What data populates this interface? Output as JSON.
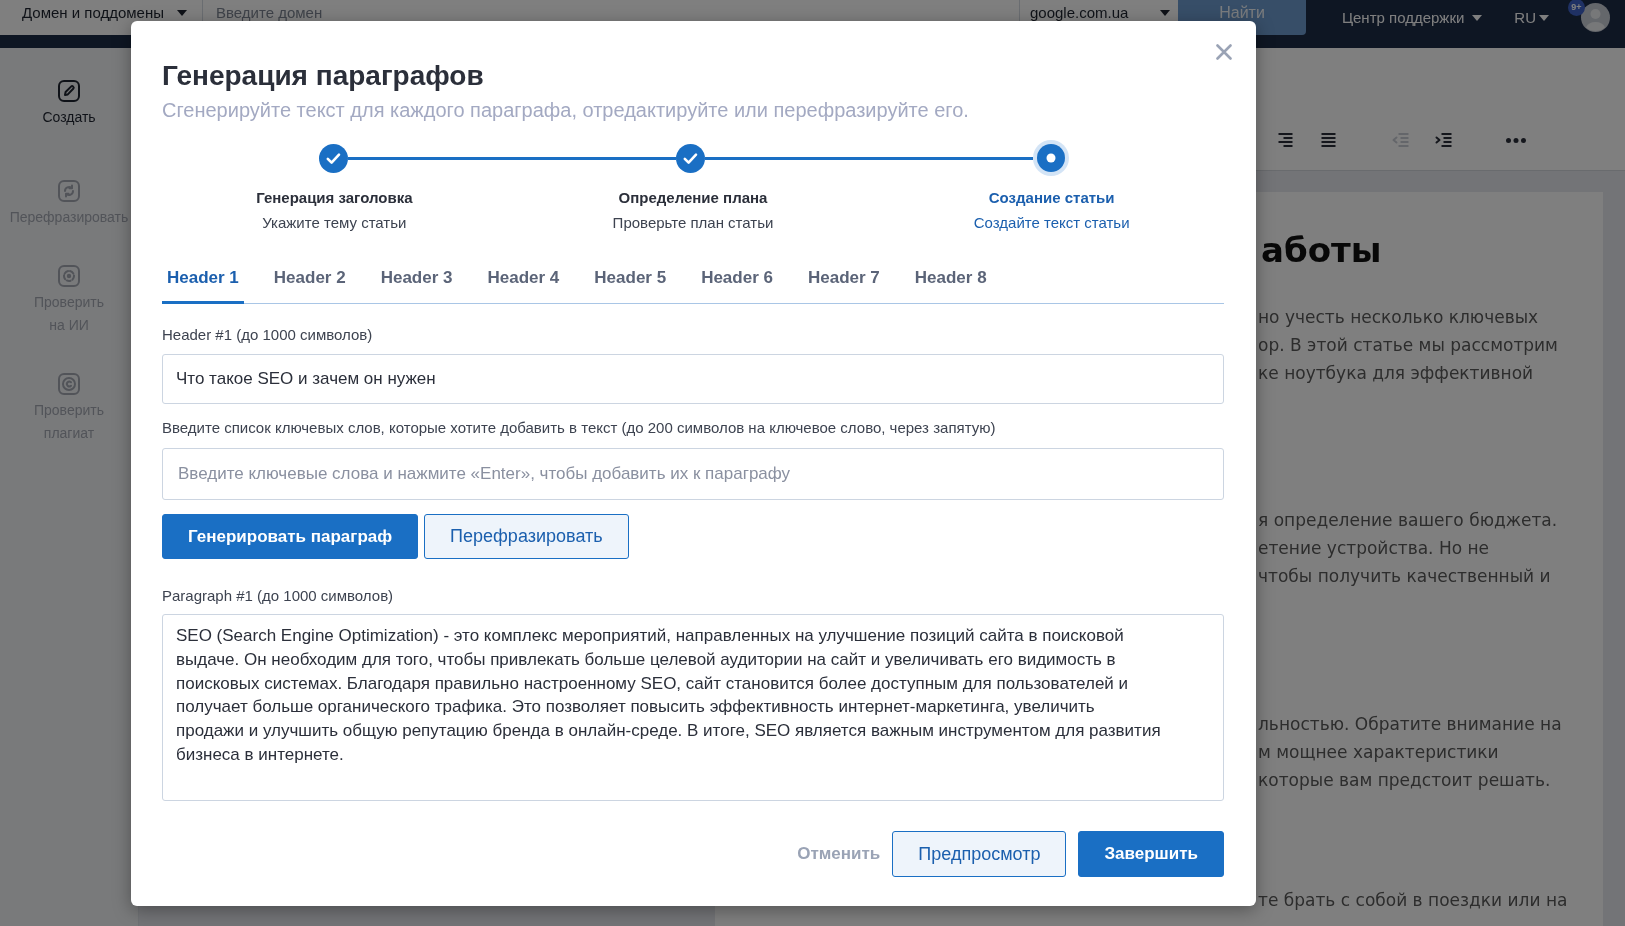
{
  "top_bar": {
    "scope_dropdown": {
      "label": "Домен и поддомены"
    },
    "domain_input": {
      "placeholder": "Введите домен"
    },
    "engine_select": {
      "value": "google.com.ua"
    },
    "search_button": {
      "label": "Найти",
      "disabled": true
    },
    "support_menu": {
      "label": "Центр поддержки"
    },
    "language_menu": {
      "label": "RU"
    },
    "notifications_badge": "9+"
  },
  "sidebar": {
    "items": [
      {
        "label": "Создать",
        "kind": "create",
        "selected": true
      },
      {
        "label": "Перефразировать",
        "kind": "paraphrase",
        "selected": false
      },
      {
        "label": "Проверить на ИИ",
        "kind": "detector",
        "selected": false
      },
      {
        "label": "Проверить плагиат",
        "kind": "plagiarism",
        "selected": false
      }
    ]
  },
  "editor": {
    "toolbar": [
      {
        "kind": "right",
        "disabled": false
      },
      {
        "kind": "justify",
        "disabled": false
      },
      {
        "kind": "outdent",
        "disabled": true
      },
      {
        "kind": "indent",
        "disabled": false
      },
      {
        "kind": "more",
        "disabled": false
      }
    ],
    "heading": "аботы",
    "paragraphs": [
      [
        "но учесть несколько ключевых",
        "ор. В этой статье мы рассмотрим",
        "ке ноутбука для эффективной"
      ],
      [
        "я определение вашего бюджета.",
        "етение устройства. Но не",
        "чтобы получить качественный и"
      ],
      [
        "льностью. Обратите внимание на",
        "м мощнее характеристики",
        "которые вам предстоит решать."
      ],
      [
        "те брать с собой в поездки или на"
      ]
    ]
  },
  "dialog": {
    "title": "Генерация параграфов",
    "subtitle": "Сгенерируйте текст для каждого параграфа, отредактируйте или перефразируйте его.",
    "steps": [
      {
        "title": "Генерация заголовка",
        "subtitle": "Укажите тему статьи",
        "completed": true,
        "selected": false
      },
      {
        "title": "Определение плана",
        "subtitle": "Проверьте план статьи",
        "completed": true,
        "selected": false
      },
      {
        "title": "Создание статьи",
        "subtitle": "Создайте текст статьи",
        "completed": false,
        "selected": true
      }
    ],
    "tabs": [
      {
        "label": "Header 1",
        "selected": true
      },
      {
        "label": "Header 2",
        "selected": false
      },
      {
        "label": "Header 3",
        "selected": false
      },
      {
        "label": "Header 4",
        "selected": false
      },
      {
        "label": "Header 5",
        "selected": false
      },
      {
        "label": "Header 6",
        "selected": false
      },
      {
        "label": "Header 7",
        "selected": false
      },
      {
        "label": "Header 8",
        "selected": false
      }
    ],
    "header_field": {
      "label": "Header #1 (до 1000 символов)",
      "value": "Что такое SEO и зачем он нужен"
    },
    "keywords_field": {
      "label": "Введите список ключевых слов, которые хотите добавить в текст (до 200 символов на ключевое слово, через запятую)",
      "placeholder": "Введите ключевые слова и нажмите «Enter», чтобы добавить их к параграфу"
    },
    "actions": [
      {
        "label": "Генерировать параграф",
        "kind": "primary"
      },
      {
        "label": "Перефразировать",
        "kind": "secondary"
      }
    ],
    "paragraph_field": {
      "label": "Paragraph #1 (до 1000 символов)",
      "value": "SEO (Search Engine Optimization) - это комплекс мероприятий, направленных на улучшение позиций сайта в поисковой выдаче. Он необходим для того, чтобы привлекать больше целевой аудитории на сайт и увеличивать его видимость в поисковых системах. Благодаря правильно настроенному SEO, сайт становится более доступным для пользователей и получает больше органического трафика. Это позволяет повысить эффективность интернет-маркетинга, увеличить продажи и улучшить общую репутацию бренда в онлайн-среде. В итоге, SEO является важным инструментом для развития бизнеса в интернете."
    },
    "footer_buttons": [
      {
        "label": "Отменить",
        "kind": "link"
      },
      {
        "label": "Предпросмотр",
        "kind": "secondary"
      },
      {
        "label": "Завершить",
        "kind": "primary"
      }
    ]
  }
}
